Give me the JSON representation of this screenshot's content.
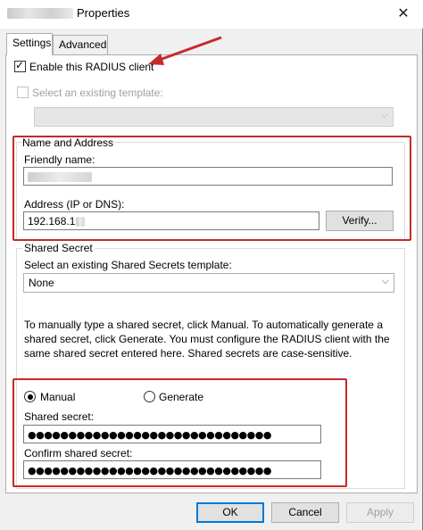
{
  "window": {
    "title": "Properties",
    "close_glyph": "✕"
  },
  "tabs": [
    {
      "label": "Settings"
    },
    {
      "label": "Advanced"
    }
  ],
  "enable_client": {
    "label": "Enable this RADIUS client",
    "checked": true
  },
  "template": {
    "label": "Select an existing template:",
    "checked": false,
    "value": ""
  },
  "name_address": {
    "group_label": "Name and Address",
    "friendly_label": "Friendly name:",
    "address_label": "Address (IP or DNS):",
    "address_value": "192.168.1",
    "verify_label": "Verify..."
  },
  "shared_secret": {
    "group_label": "Shared Secret",
    "template_label": "Select an existing Shared Secrets template:",
    "template_value": "None",
    "description": "To manually type a shared secret, click Manual. To automatically generate a shared secret, click Generate. You must configure the RADIUS client with the same shared secret entered here. Shared secrets are case-sensitive.",
    "manual_label": "Manual",
    "generate_label": "Generate",
    "selected_mode": "Manual",
    "secret_label": "Shared secret:",
    "secret_value": "●●●●●●●●●●●●●●●●●●●●●●●●●●●●●●",
    "confirm_label": "Confirm shared secret:",
    "confirm_value": "●●●●●●●●●●●●●●●●●●●●●●●●●●●●●●"
  },
  "buttons": {
    "ok": "OK",
    "cancel": "Cancel",
    "apply": "Apply"
  },
  "colors": {
    "highlight": "#c42b2b",
    "accent": "#0078d7"
  }
}
